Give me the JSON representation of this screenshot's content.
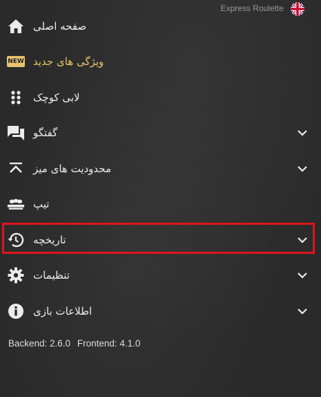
{
  "header": {
    "game_title": "Express Roulette",
    "language_flag_icon": "uk-flag-icon"
  },
  "menu": {
    "items": [
      {
        "label": "صفحه اصلی",
        "icon": "home-icon",
        "expandable": false
      },
      {
        "label": "ویژگی های جدید",
        "icon": "new-badge-icon",
        "badge": "NEW",
        "expandable": false,
        "color": "#e8c56c"
      },
      {
        "label": "لابی کوچک",
        "icon": "grid-dots-icon",
        "expandable": false
      },
      {
        "label": "گفتگو",
        "icon": "chat-icon",
        "expandable": true
      },
      {
        "label": "محدودیت های میز",
        "icon": "limits-icon",
        "expandable": true
      },
      {
        "label": "تیپ",
        "icon": "tip-icon",
        "expandable": false
      },
      {
        "label": "تاریخچه",
        "icon": "history-icon",
        "expandable": true,
        "highlighted": true
      },
      {
        "label": "تنظیمات",
        "icon": "gear-icon",
        "expandable": true
      },
      {
        "label": "اطلاعات بازی",
        "icon": "info-icon",
        "expandable": true
      }
    ]
  },
  "version": {
    "backend": "Backend: 2.6.0",
    "frontend": "Frontend: 4.1.0"
  },
  "colors": {
    "background": "#2a2a2a",
    "accent_gold": "#e8c56c",
    "highlight_red": "#e0141b",
    "text": "#ececec"
  }
}
